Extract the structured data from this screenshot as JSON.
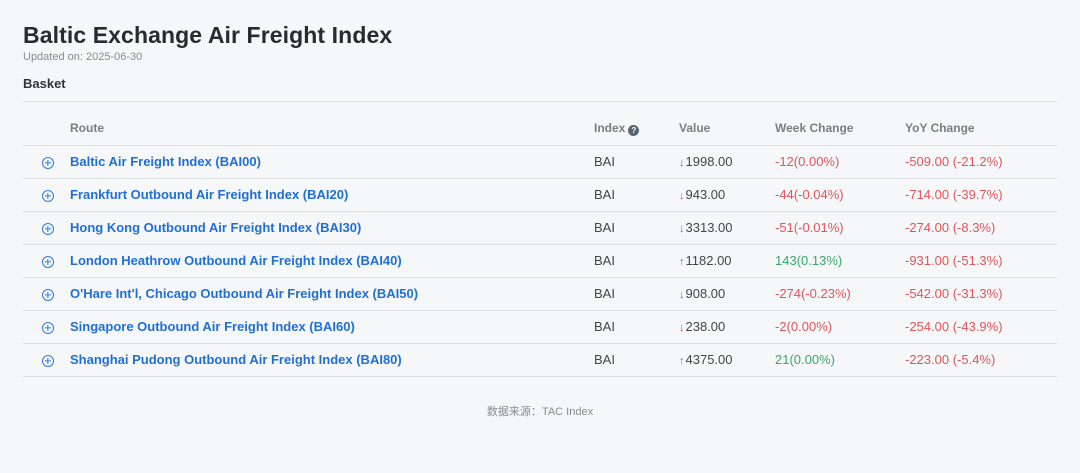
{
  "title": "Baltic Exchange Air Freight Index",
  "updated": "Updated on: 2025-06-30",
  "section": "Basket",
  "table": {
    "headers": {
      "route": "Route",
      "index": "Index",
      "value": "Value",
      "week": "Week Change",
      "yoy": "YoY Change"
    },
    "rows": [
      {
        "route": "Baltic Air Freight Index (BAI00)",
        "index": "BAI",
        "direction": "down",
        "value": "1998.00",
        "week": "-12(0.00%)",
        "yoy": "-509.00 (-21.2%)"
      },
      {
        "route": "Frankfurt Outbound Air Freight Index (BAI20)",
        "index": "BAI",
        "direction": "down",
        "value": "943.00",
        "week": "-44(-0.04%)",
        "yoy": "-714.00 (-39.7%)"
      },
      {
        "route": "Hong Kong Outbound Air Freight Index (BAI30)",
        "index": "BAI",
        "direction": "down",
        "value": "3313.00",
        "week": "-51(-0.01%)",
        "yoy": "-274.00 (-8.3%)"
      },
      {
        "route": "London Heathrow Outbound Air Freight Index (BAI40)",
        "index": "BAI",
        "direction": "up",
        "value": "1182.00",
        "week": "143(0.13%)",
        "yoy": "-931.00 (-51.3%)"
      },
      {
        "route": "O'Hare Int'l, Chicago Outbound Air Freight Index (BAI50)",
        "index": "BAI",
        "direction": "down",
        "value": "908.00",
        "week": "-274(-0.23%)",
        "yoy": "-542.00 (-31.3%)"
      },
      {
        "route": "Singapore Outbound Air Freight Index (BAI60)",
        "index": "BAI",
        "direction": "down",
        "value": "238.00",
        "week": "-2(0.00%)",
        "yoy": "-254.00 (-43.9%)"
      },
      {
        "route": "Shanghai Pudong Outbound Air Freight Index (BAI80)",
        "index": "BAI",
        "direction": "up",
        "value": "4375.00",
        "week": "21(0.00%)",
        "yoy": "-223.00 (-5.4%)"
      }
    ]
  },
  "footer": "数据来源：TAC Index",
  "icons": {
    "expand": "plus-circle-icon",
    "help": "question-circle-icon",
    "down": "arrow-down-icon",
    "up": "arrow-up-icon"
  },
  "colors": {
    "link": "#1f6fd6",
    "negative": "#e0555a",
    "positive": "#38a86f"
  }
}
